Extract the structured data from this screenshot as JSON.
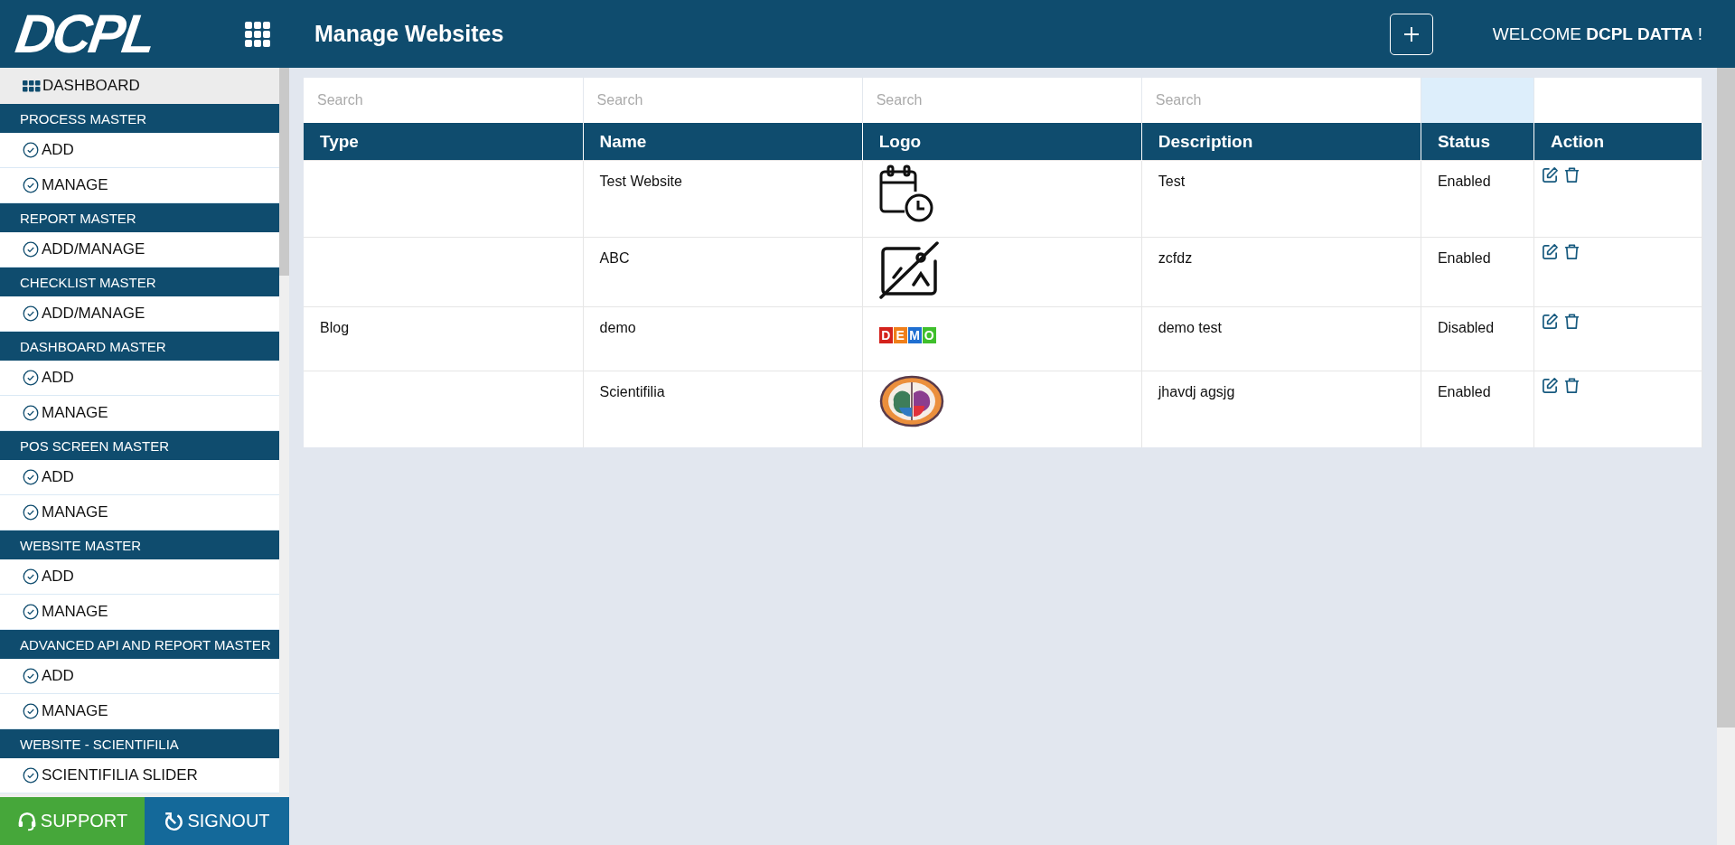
{
  "header": {
    "logo": "DCPL",
    "title": "Manage Websites",
    "welcome": "WELCOME **DCPL DATTA** !"
  },
  "sidebar": {
    "dashboard": "DASHBOARD",
    "sections": [
      {
        "title": "PROCESS MASTER",
        "items": [
          "ADD",
          "MANAGE"
        ]
      },
      {
        "title": "REPORT MASTER",
        "items": [
          "ADD/MANAGE"
        ]
      },
      {
        "title": "CHECKLIST MASTER",
        "items": [
          "ADD/MANAGE"
        ]
      },
      {
        "title": "DASHBOARD MASTER",
        "items": [
          "ADD",
          "MANAGE"
        ]
      },
      {
        "title": "POS SCREEN MASTER",
        "items": [
          "ADD",
          "MANAGE"
        ]
      },
      {
        "title": "WEBSITE MASTER",
        "items": [
          "ADD",
          "MANAGE"
        ]
      },
      {
        "title": "ADVANCED API AND REPORT MASTER",
        "items": [
          "ADD",
          "MANAGE"
        ]
      },
      {
        "title": "WEBSITE - SCIENTIFILIA",
        "items": [
          "SCIENTIFILIA SLIDER"
        ]
      }
    ],
    "footer": {
      "support": "SUPPORT",
      "signout": "SIGNOUT"
    }
  },
  "table": {
    "columns": [
      {
        "label": "Type",
        "filter_placeholder": "Search"
      },
      {
        "label": "Name",
        "filter_placeholder": "Search"
      },
      {
        "label": "Logo",
        "filter_placeholder": "Search"
      },
      {
        "label": "Description",
        "filter_placeholder": "Search"
      },
      {
        "label": "Status"
      },
      {
        "label": "Action"
      }
    ],
    "rows": [
      {
        "type": "",
        "name": "Test Website",
        "logo": {
          "kind": "calendar"
        },
        "description": "Test",
        "status": "Enabled"
      },
      {
        "type": "",
        "name": "ABC",
        "logo": {
          "kind": "no-image"
        },
        "description": "zcfdz",
        "status": "Enabled"
      },
      {
        "type": "Blog",
        "name": "demo",
        "logo": {
          "kind": "tiles",
          "letters": [
            "D",
            "E",
            "M",
            "O"
          ]
        },
        "description": "demo test",
        "status": "Disabled"
      },
      {
        "type": "",
        "name": "Scientifilia",
        "logo": {
          "kind": "emblem"
        },
        "description": "jhavdj agsjg",
        "status": "Enabled"
      }
    ]
  }
}
